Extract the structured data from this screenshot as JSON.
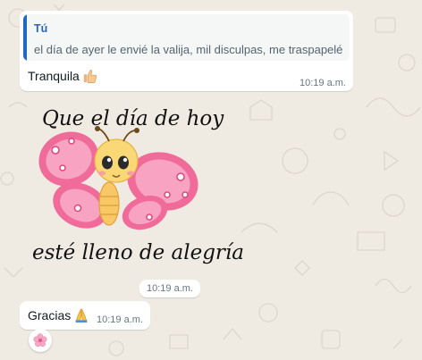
{
  "colors": {
    "background": "#efeae2",
    "bubble": "#ffffff",
    "quote_accent": "#1f69c4",
    "meta_text": "#667781"
  },
  "messages": [
    {
      "quote": {
        "author": "Tú",
        "text": "el día de ayer le envié la valija, mil disculpas, me traspapelé"
      },
      "text": "Tranquila",
      "emoji": "thumbs-up-icon",
      "time": "10:19 a.m."
    },
    {
      "sticker": {
        "line1": "Que el día de hoy",
        "line2": "esté lleno de alegría",
        "image": "butterfly-sticker"
      },
      "time": "10:19 a.m."
    },
    {
      "text": "Gracias",
      "emoji": "folded-hands-icon",
      "time": "10:19 a.m.",
      "reaction": "cherry-blossom-icon"
    }
  ]
}
